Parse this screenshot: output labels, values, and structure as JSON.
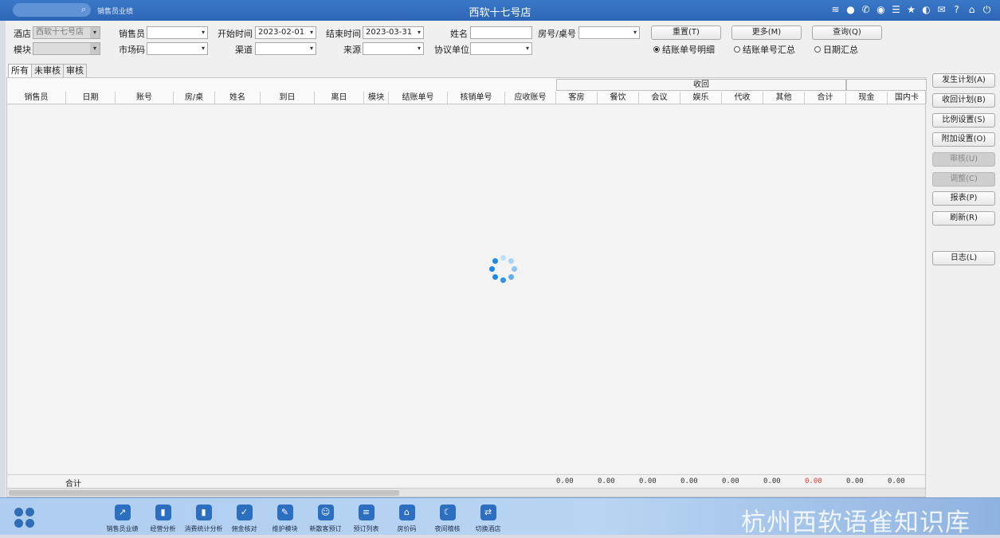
{
  "titlebar": {
    "app_name": "销售员业绩",
    "title": "西软十七号店",
    "icons": [
      "wifi-icon",
      "chat-icon",
      "phone-icon",
      "palette-icon",
      "menu-icon",
      "star-icon",
      "moon-icon",
      "mail-icon",
      "help-icon",
      "home-icon",
      "power-icon"
    ]
  },
  "filters": {
    "hotel_label": "酒店",
    "hotel_value": "西软十七号店",
    "module_label": "模块",
    "salesperson_label": "销售员",
    "market_label": "市场码",
    "start_label": "开始时间",
    "start_value": "2023-02-01",
    "channel_label": "渠道",
    "end_label": "结束时间",
    "end_value": "2023-03-31",
    "source_label": "来源",
    "name_label": "姓名",
    "agreement_label": "协议单位",
    "room_label": "房号/桌号"
  },
  "buttons": {
    "reset": "重置(T)",
    "more": "更多(M)",
    "query": "查询(Q)"
  },
  "radios": {
    "detail": "结账单号明细",
    "summary": "结账单号汇总",
    "date_summary": "日期汇总"
  },
  "tabs": [
    "所有",
    "未审核",
    "审核"
  ],
  "table": {
    "group_label": "收回",
    "columns": [
      "销售员",
      "日期",
      "账号",
      "房/桌",
      "姓名",
      "到日",
      "离日",
      "模块",
      "结账单号",
      "核销单号",
      "应收账号",
      "客房",
      "餐饮",
      "会议",
      "娱乐",
      "代收",
      "其他",
      "合计",
      "现金",
      "国内卡"
    ],
    "total_label": "合计",
    "totals": [
      "0.00",
      "0.00",
      "0.00",
      "0.00",
      "0.00",
      "0.00",
      "0.00",
      "0.00",
      "0.00"
    ]
  },
  "side": {
    "plan_occur": "发生计划(A)",
    "plan_recover": "收回计划(B)",
    "ratio": "比例设置(S)",
    "extra": "附加设置(O)",
    "audit": "审核(U)",
    "adjust": "调整(C)",
    "report": "报表(P)",
    "refresh": "刷新(R)",
    "log": "日志(L)"
  },
  "dock": [
    {
      "label": "销售员业绩",
      "icon": "chart-icon"
    },
    {
      "label": "经营分析",
      "icon": "bar-icon"
    },
    {
      "label": "消费统计分析",
      "icon": "stats-icon"
    },
    {
      "label": "佣金核对",
      "icon": "check-icon"
    },
    {
      "label": "维护模块",
      "icon": "wrench-icon"
    },
    {
      "label": "新散客预订",
      "icon": "user-icon"
    },
    {
      "label": "预订列表",
      "icon": "list-icon"
    },
    {
      "label": "房价码",
      "icon": "house-icon"
    },
    {
      "label": "夜间稽核",
      "icon": "moon-icon"
    },
    {
      "label": "切换酒店",
      "icon": "switch-icon"
    }
  ],
  "watermark": "杭州西软语雀知识库",
  "colors": {
    "accent": "#2e66b6",
    "spinner": "#1e88e5",
    "total_red": "#e53935"
  }
}
